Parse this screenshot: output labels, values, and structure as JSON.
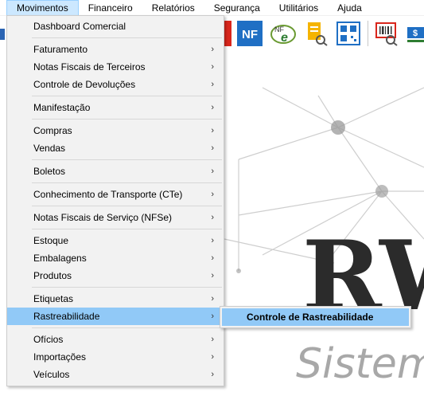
{
  "menubar": {
    "items": [
      "Movimentos",
      "Financeiro",
      "Relatórios",
      "Segurança",
      "Utilitários",
      "Ajuda"
    ]
  },
  "toolbar": {
    "nf_label": "NF",
    "nfe_label": "NFe",
    "icons": [
      "nf-red-icon",
      "nf-icon",
      "nfe-icon",
      "document-search-icon",
      "qr-code-icon",
      "barcode-search-icon",
      "money-icon"
    ]
  },
  "background": {
    "logo_text": "RW",
    "tagline": "Sistem"
  },
  "menu": {
    "items": [
      {
        "label": "Dashboard Comercial",
        "submenu": false
      },
      {
        "sep": true
      },
      {
        "label": "Faturamento",
        "submenu": true
      },
      {
        "label": "Notas Fiscais de Terceiros",
        "submenu": true
      },
      {
        "label": "Controle de Devoluções",
        "submenu": true
      },
      {
        "sep": true
      },
      {
        "label": "Manifestação",
        "submenu": true
      },
      {
        "sep": true
      },
      {
        "label": "Compras",
        "submenu": true
      },
      {
        "label": "Vendas",
        "submenu": true
      },
      {
        "sep": true
      },
      {
        "label": "Boletos",
        "submenu": true
      },
      {
        "sep": true
      },
      {
        "label": "Conhecimento de Transporte (CTe)",
        "submenu": true
      },
      {
        "sep": true
      },
      {
        "label": "Notas Fiscais de Serviço (NFSe)",
        "submenu": true
      },
      {
        "sep": true
      },
      {
        "label": "Estoque",
        "submenu": true
      },
      {
        "label": "Embalagens",
        "submenu": true
      },
      {
        "label": "Produtos",
        "submenu": true
      },
      {
        "sep": true
      },
      {
        "label": "Etiquetas",
        "submenu": true
      },
      {
        "label": "Rastreabilidade",
        "submenu": true,
        "highlighted": true
      },
      {
        "sep": true
      },
      {
        "label": "Ofícios",
        "submenu": true
      },
      {
        "label": "Importações",
        "submenu": true
      },
      {
        "label": "Veículos",
        "submenu": true
      }
    ],
    "arrow_glyph": "›"
  },
  "submenu": {
    "items": [
      "Controle de Rastreabilidade"
    ]
  }
}
